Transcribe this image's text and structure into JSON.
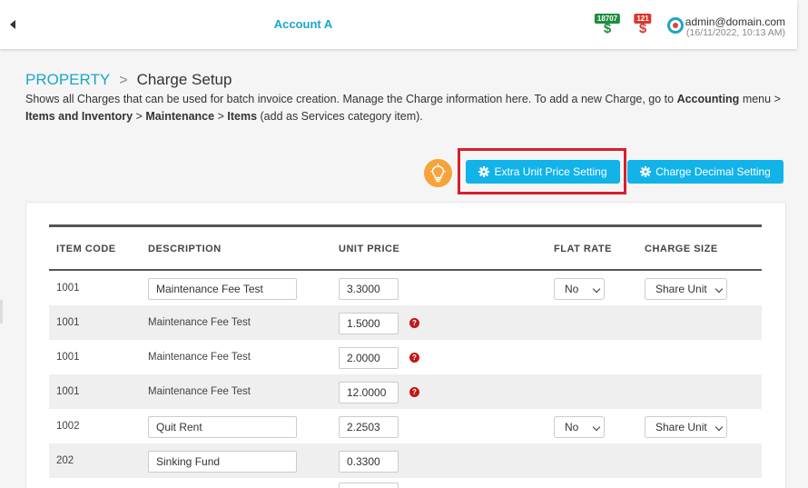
{
  "header": {
    "title": "Account A",
    "green_badge": {
      "count": "18707",
      "glyph": "$",
      "color": "#1e8e3e",
      "icon": "money-in-icon"
    },
    "red_badge": {
      "count": "121",
      "glyph": "$",
      "color": "#d9372f",
      "icon": "money-out-icon"
    },
    "notification_icon": "notification-icon",
    "user_email": "admin@domain.com",
    "user_time": "(16/11/2022, 10:13 AM)"
  },
  "breadcrumb": {
    "root": "PROPERTY",
    "separator": ">",
    "current": "Charge Setup"
  },
  "description": {
    "intro": "Shows all Charges that can be used for batch invoice creation. Manage the Charge information here. To add a new Charge, go to",
    "accounting": "Accounting",
    "menu_word": "menu",
    "sep": ">",
    "items_and_inventory": "Items and Inventory",
    "maintenance": "Maintenance",
    "items": "Items",
    "suffix": "(add as Services category item)."
  },
  "toolbar": {
    "tip_icon": "lightbulb-icon",
    "extra_unit_price_label": "Extra Unit Price Setting",
    "charge_decimal_label": "Charge Decimal Setting"
  },
  "table": {
    "headers": {
      "item_code": "ITEM CODE",
      "description": "DESCRIPTION",
      "unit_price": "UNIT PRICE",
      "flat_rate": "FLAT RATE",
      "charge_size": "CHARGE SIZE"
    },
    "rows": [
      {
        "code": "1001",
        "description": "Maintenance Fee Test",
        "unit_price": "3.3000",
        "flat_rate": "No",
        "charge_size": "Share Unit"
      },
      {
        "code": "1001",
        "description": "Maintenance Fee Test",
        "unit_price": "1.5000",
        "help": "?"
      },
      {
        "code": "1001",
        "description": "Maintenance Fee Test",
        "unit_price": "2.0000",
        "help": "?"
      },
      {
        "code": "1001",
        "description": "Maintenance Fee Test",
        "unit_price": "12.0000",
        "help": "?"
      },
      {
        "code": "1002",
        "description": "Quit Rent",
        "unit_price": "2.2503",
        "flat_rate": "No",
        "charge_size": "Share Unit"
      },
      {
        "code": "202",
        "description": "Sinking Fund",
        "unit_price": "0.3300"
      }
    ]
  },
  "colors": {
    "accent": "#11b3e8",
    "link": "#1aa6c8",
    "highlight": "#d81e2a",
    "tip": "#f5a33a"
  }
}
